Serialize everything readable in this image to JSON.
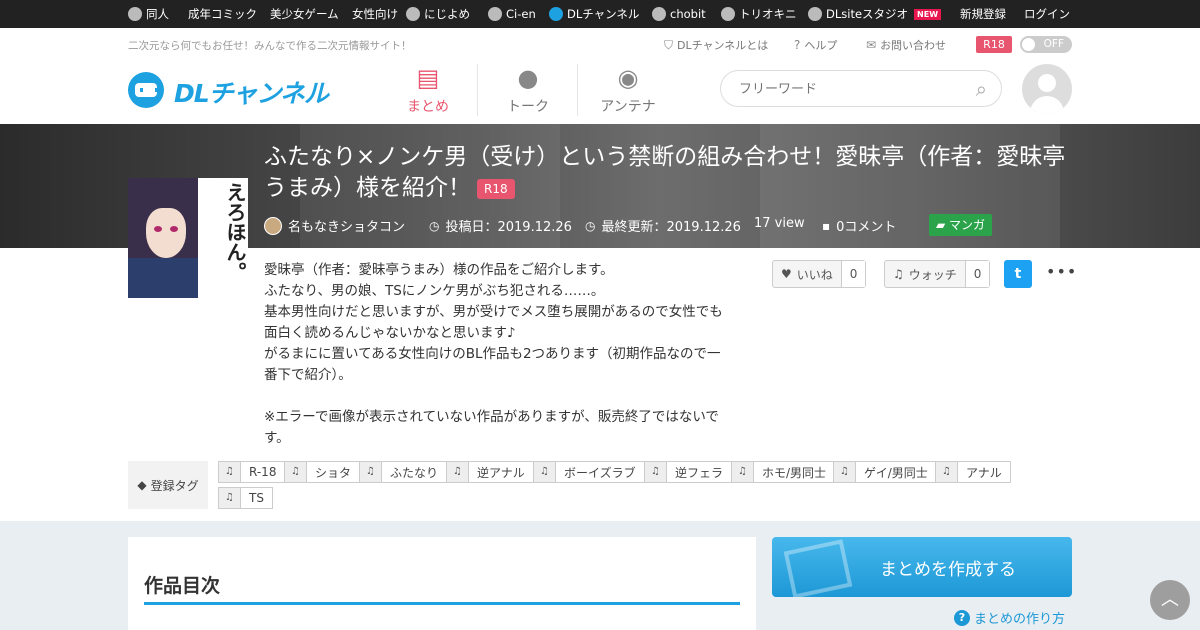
{
  "topbar": {
    "items": [
      {
        "label": "同人",
        "icon": "dl-icon"
      },
      {
        "label": "成年コミック"
      },
      {
        "label": "美少女ゲーム"
      },
      {
        "label": "女性向け"
      },
      {
        "label": "にじよめ",
        "icon": "nijiyome-icon"
      },
      {
        "label": "Ci-en",
        "icon": "cien-icon"
      },
      {
        "label": "DLチャンネル",
        "icon": "dlchannel-icon"
      },
      {
        "label": "chobit",
        "icon": "chobit-icon"
      },
      {
        "label": "トリオキニ",
        "icon": "triokini-icon"
      },
      {
        "label": "DLsiteスタジオ",
        "icon": "headphones-icon",
        "badge": "NEW"
      },
      {
        "label": "新規登録"
      },
      {
        "label": "ログイン"
      }
    ]
  },
  "header": {
    "tagline": "二次元なら何でもお任せ！みんなで作る二次元情報サイト！",
    "util": {
      "about": "DLチャンネルとは",
      "help": "ヘルプ",
      "contact": "お問い合わせ"
    },
    "r18": "R18",
    "toggle": "OFF",
    "logo_text": "DLチャンネル",
    "nav": [
      {
        "label": "まとめ",
        "icon": "matome-icon",
        "active": true
      },
      {
        "label": "トーク",
        "icon": "talk-bubble-icon"
      },
      {
        "label": "アンテナ",
        "icon": "antenna-icon"
      }
    ],
    "search_placeholder": "フリーワード"
  },
  "article": {
    "title": "ふたなり×ノンケ男（受け）という禁断の組み合わせ！愛昧亭（作者：愛昧亭うまみ）様を紹介！",
    "rating_badge": "R18",
    "author": "名もなきショタコン",
    "posted": "投稿日：2019.12.26",
    "updated": "最終更新：2019.12.26",
    "views": "17 view",
    "comments": "0コメント",
    "category": "マンガ",
    "thumb_text": "えろほん。",
    "description": "愛昧亭（作者：愛昧亭うまみ）様の作品をご紹介します。\nふたなり、男の娘、TSにノンケ男がぶち犯される……。\n基本男性向けだと思いますが、男が受けでメス堕ち展開があるので女性でも面白く読めるんじゃないかなと思います♪\nがるまにに置いてある女性向けのBL作品も2つあります（初期作品なので一番下で紹介）。\n\n※エラーで画像が表示されていない作品がありますが、販売終了ではないです。",
    "like": {
      "label": "いいね",
      "count": "0"
    },
    "watch": {
      "label": "ウォッチ",
      "count": "0"
    },
    "tags_label": "登録タグ",
    "tags": [
      "R-18",
      "ショタ",
      "ふたなり",
      "逆アナル",
      "ボーイズラブ",
      "逆フェラ",
      "ホモ/男同士",
      "ゲイ/男同士",
      "アナル",
      "TS"
    ]
  },
  "toc": {
    "title": "作品目次"
  },
  "sidebar": {
    "create_label": "まとめを作成する",
    "howto_label": "まとめの作り方"
  },
  "colors": {
    "brand": "#1da1e0",
    "accent": "#e8556e",
    "category": "#2aa34a"
  }
}
